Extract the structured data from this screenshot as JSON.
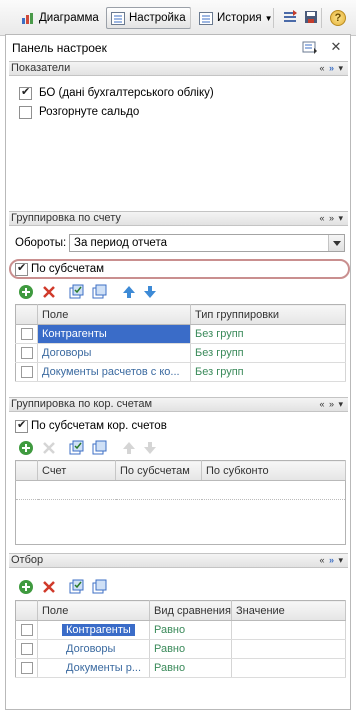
{
  "toolbar": {
    "diagram_label": "Диаграмма",
    "settings_label": "Настройка",
    "history_label": "История",
    "help_label": "?"
  },
  "panel": {
    "title": "Панель настроек"
  },
  "indicators": {
    "title": "Показатели",
    "items": [
      {
        "label": "БО (дані бухгалтерського обліку)",
        "checked": true
      },
      {
        "label": "Розгорнуте сальдо",
        "checked": false
      }
    ]
  },
  "account_grouping": {
    "title": "Группировка по счету",
    "turnover_label": "Обороты:",
    "turnover_value": "За период отчета",
    "subaccounts_label": "По субсчетам",
    "subaccounts_checked": true,
    "table": {
      "columns": [
        "Поле",
        "Тип группировки"
      ],
      "rows": [
        {
          "field": "Контрагенты",
          "type": "Без групп",
          "selected": true
        },
        {
          "field": "Договоры",
          "type": "Без групп",
          "selected": false
        },
        {
          "field": "Документы расчетов с ко...",
          "type": "Без групп",
          "selected": false
        }
      ]
    }
  },
  "corr_grouping": {
    "title": "Группировка по кор. счетам",
    "subaccounts_label": "По субсчетам кор. счетов",
    "subaccounts_checked": true,
    "table": {
      "columns": [
        "Счет",
        "По субсчетам",
        "По субконто"
      ]
    }
  },
  "filter": {
    "title": "Отбор",
    "table": {
      "columns": [
        "Поле",
        "Вид сравнения",
        "Значение"
      ],
      "rows": [
        {
          "field": "Контрагенты",
          "comparison": "Равно",
          "value": ""
        },
        {
          "field": "Договоры",
          "comparison": "Равно",
          "value": ""
        },
        {
          "field": "Документы р...",
          "comparison": "Равно",
          "value": ""
        }
      ]
    }
  },
  "colors": {
    "accent": "#3a6cc8",
    "highlight_ring": "#c98f8f",
    "link": "#3b6aa0"
  }
}
